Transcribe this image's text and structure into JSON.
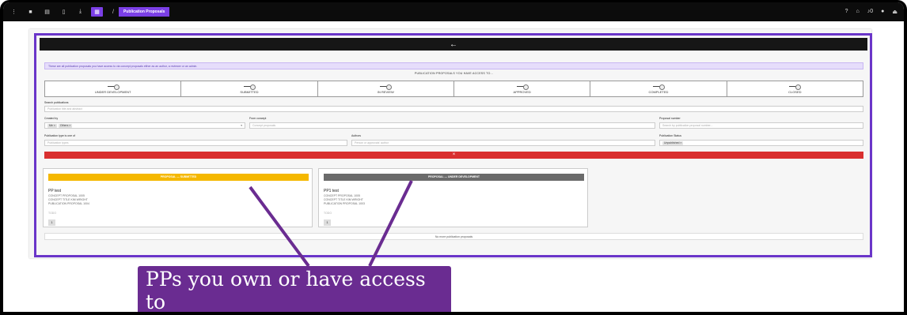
{
  "topbar": {
    "icons": [
      "more-vertical-icon",
      "grid-icon",
      "table-icon",
      "document-icon",
      "download-icon",
      "calendar-icon"
    ],
    "separator": "/",
    "breadcrumb": "Publication Proposals",
    "right_icons": [
      "help-icon",
      "home-icon",
      "bell-icon",
      "user-icon",
      "logout-icon"
    ],
    "notification_count": "0"
  },
  "back_label": "←",
  "info_text": "These are all publication proposals you have access to via concept proposals either as an author, a reviewer or an admin.",
  "section_title": "PUBLICATION PROPOSALS YOU HAVE ACCESS TO...",
  "stages": [
    {
      "label": "UNDER DEVELOPMENT"
    },
    {
      "label": "SUBMITTED"
    },
    {
      "label": "IN REVIEW"
    },
    {
      "label": "APPROVED"
    },
    {
      "label": "COMPLETED"
    },
    {
      "label": "CLOSED"
    }
  ],
  "filters": {
    "search_label": "Search publications",
    "search_placeholder": "Publication title and abstract",
    "created_by_label": "Created by",
    "created_by_chips": [
      "Me ×",
      "Others ×"
    ],
    "from_concept_label": "From concept",
    "from_concept_placeholder": "Concept proposals",
    "proposal_number_label": "Proposal number",
    "proposal_number_placeholder": "Search by publication proposal number...",
    "pub_type_label": "Publication type is one of",
    "pub_type_placeholder": "Publication types",
    "authors_label": "Authors",
    "authors_placeholder": "Person or approvals' author",
    "pub_status_label": "Publication Status",
    "pub_status_chip": "Unpublished ×",
    "clear_label": "×"
  },
  "cards": [
    {
      "header": "PROPOSAL — SUBMITTED",
      "header_color": "#f5b800",
      "title": "PP test",
      "lines": [
        "CONCEPT PROPOSAL 1005",
        "CONCEPT TITLE KIM WRIGHT",
        "PUBLICATION PROPOSAL 1004"
      ],
      "todo": "TODO",
      "badge": "1"
    },
    {
      "header": "PROPOSAL — UNDER DEVELOPMENT",
      "header_color": "#6b6b6b",
      "title": "PP1 test",
      "lines": [
        "CONCEPT PROPOSAL 1005",
        "CONCEPT TITLE KIM WRIGHT",
        "PUBLICATION PROPOSAL 1003"
      ],
      "todo": "TODO",
      "badge": "1"
    }
  ],
  "no_more": "No more publication proposals",
  "callout": "PPs you own or have access to",
  "colors": {
    "accent": "#7b3fe6",
    "callout": "#6a2c91",
    "danger": "#d93030"
  }
}
